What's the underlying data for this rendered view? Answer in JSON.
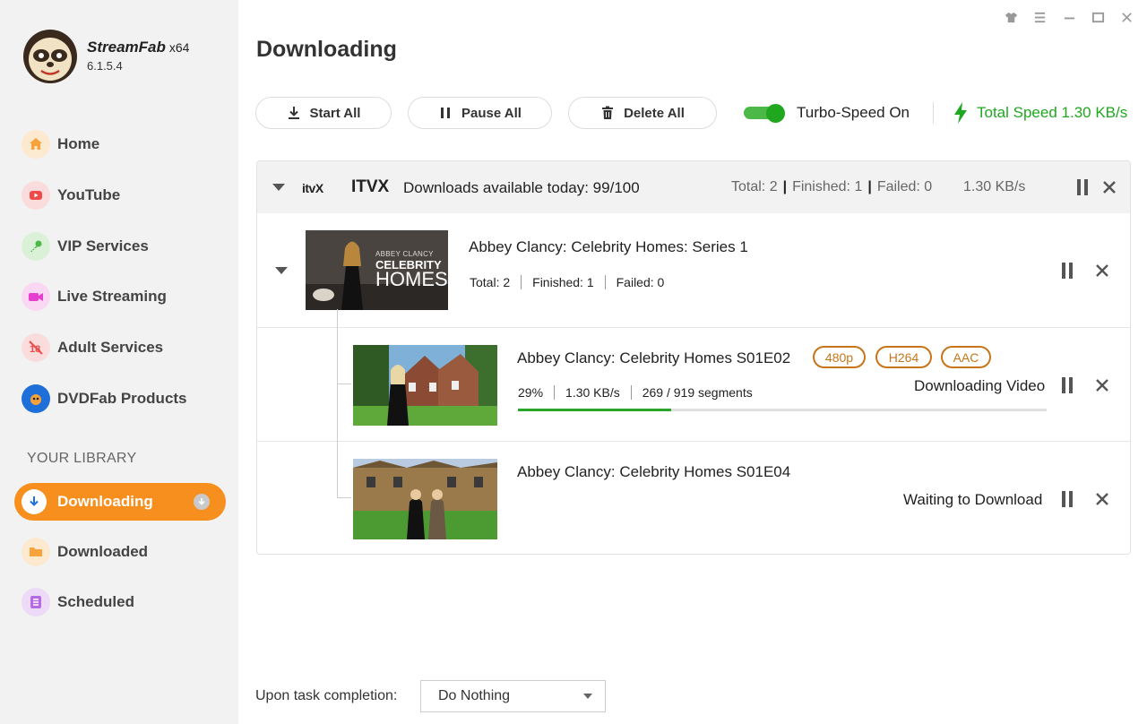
{
  "app": {
    "name": "StreamFab",
    "arch": "x64",
    "version": "6.1.5.4"
  },
  "window_controls": [
    "shirt-icon",
    "menu-icon",
    "minimize-icon",
    "maximize-icon",
    "close-icon"
  ],
  "sidebar": {
    "items": [
      {
        "label": "Home",
        "icon": "home-icon",
        "color": "#f7a23b"
      },
      {
        "label": "YouTube",
        "icon": "youtube-icon",
        "color": "#ef4a4a"
      },
      {
        "label": "VIP Services",
        "icon": "key-icon",
        "color": "#4cb846"
      },
      {
        "label": "Live Streaming",
        "icon": "camera-icon",
        "color": "#e63fd0"
      },
      {
        "label": "Adult Services",
        "icon": "adult-icon",
        "color": "#ef4a4a"
      },
      {
        "label": "DVDFab Products",
        "icon": "dvdfab-icon",
        "color": "#1f6fd8"
      }
    ],
    "library_title": "YOUR LIBRARY",
    "library": [
      {
        "label": "Downloading",
        "icon": "download-icon",
        "active": true
      },
      {
        "label": "Downloaded",
        "icon": "folder-icon",
        "color": "#f7a23b"
      },
      {
        "label": "Scheduled",
        "icon": "list-icon",
        "color": "#b46ce0"
      }
    ]
  },
  "main": {
    "title": "Downloading",
    "toolbar": {
      "start_all": "Start All",
      "pause_all": "Pause All",
      "delete_all": "Delete All",
      "turbo_label": "Turbo-Speed On",
      "turbo_on": true,
      "total_speed": "Total Speed 1.30 KB/s"
    },
    "group": {
      "logo_text": "itvX",
      "name": "ITVX",
      "availability": "Downloads available today: 99/100",
      "total": "Total: 2",
      "finished": "Finished: 1",
      "failed": "Failed: 0",
      "speed": "1.30 KB/s",
      "series": {
        "title": "Abbey Clancy: Celebrity Homes: Series 1",
        "thumb_text": [
          "ABBEY CLANCY",
          "CELEBRITY",
          "HOMES"
        ],
        "total": "Total: 2",
        "finished": "Finished: 1",
        "failed": "Failed: 0"
      },
      "episodes": [
        {
          "title": "Abbey Clancy: Celebrity Homes S01E02",
          "tags": [
            "480p",
            "H264",
            "AAC"
          ],
          "percent": "29%",
          "progress": 0.29,
          "speed": "1.30 KB/s",
          "segments": "269 / 919 segments",
          "status": "Downloading Video"
        },
        {
          "title": "Abbey Clancy: Celebrity Homes S01E04",
          "status": "Waiting to Download"
        }
      ]
    }
  },
  "footer": {
    "completion_label": "Upon task completion:",
    "completion_value": "Do Nothing"
  }
}
